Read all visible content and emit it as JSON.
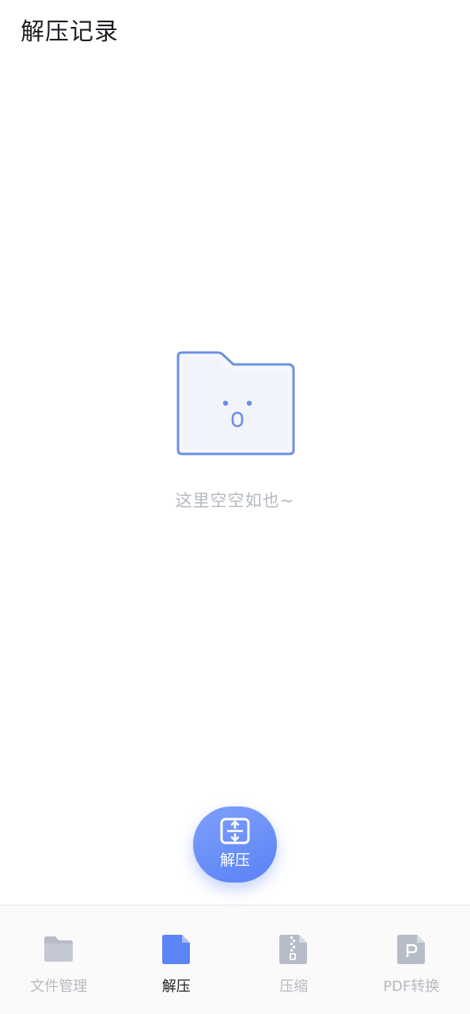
{
  "header": {
    "title": "解压记录"
  },
  "empty_state": {
    "message": "这里空空如也~",
    "icon": "empty-folder-icon"
  },
  "fab": {
    "label": "解压",
    "icon": "unzip-icon",
    "color": "#6b8ff8"
  },
  "tabbar": {
    "items": [
      {
        "label": "文件管理",
        "icon": "folder-icon",
        "active": false
      },
      {
        "label": "解压",
        "icon": "document-icon",
        "active": true
      },
      {
        "label": "压缩",
        "icon": "zip-file-icon",
        "active": false
      },
      {
        "label": "PDF转换",
        "icon": "pdf-file-icon",
        "active": false
      }
    ],
    "active_color": "#5b84f6",
    "inactive_color": "#b6b9c0"
  }
}
